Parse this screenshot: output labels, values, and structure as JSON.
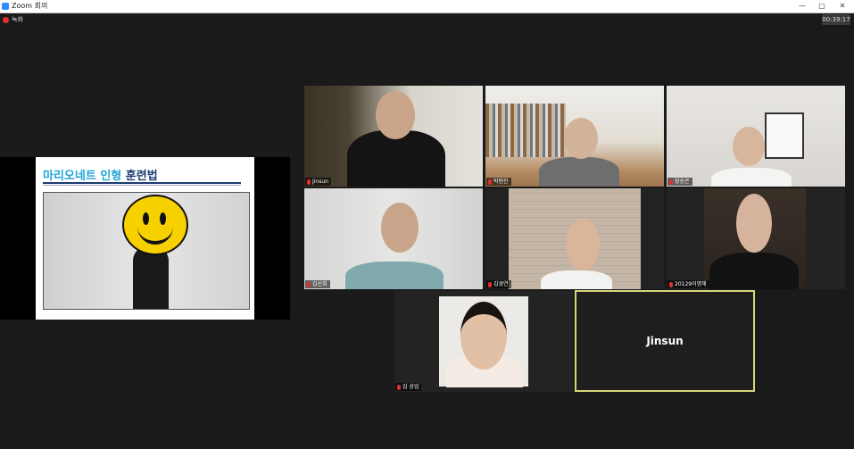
{
  "window": {
    "title": "Zoom 회의",
    "minimize": "—",
    "restore": "▢",
    "close": "✕"
  },
  "recording": {
    "label": "녹화"
  },
  "timer": "00:39:17",
  "shared_slide": {
    "title_part1": "마리오네트 인형",
    "title_part2": " 훈련법"
  },
  "participants": [
    {
      "name": "Jinsun"
    },
    {
      "name": "박현진"
    },
    {
      "name": "장승은"
    },
    {
      "name": "김선희"
    },
    {
      "name": "김경연"
    },
    {
      "name": "20129이명해"
    },
    {
      "name": "김 상임"
    }
  ],
  "active_speaker": {
    "name": "Jinsun"
  },
  "colors": {
    "accent": "#2d8cff",
    "active_border": "#d6d77a",
    "mute": "#e0312f"
  }
}
